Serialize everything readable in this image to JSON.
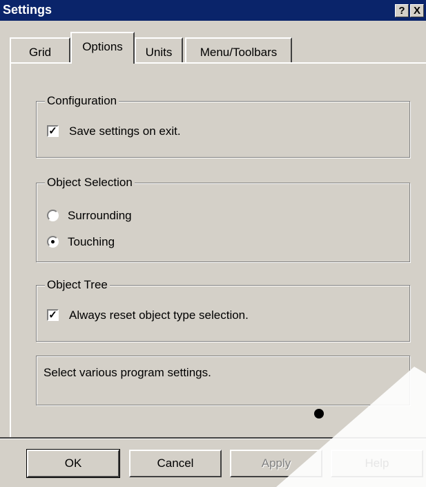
{
  "window": {
    "title": "Settings"
  },
  "titlebar": {
    "help_label": "?",
    "close_label": "X"
  },
  "tabs": [
    {
      "label": "Grid",
      "active": false
    },
    {
      "label": "Options",
      "active": true
    },
    {
      "label": "Units",
      "active": false
    },
    {
      "label": "Menu/Toolbars",
      "active": false
    }
  ],
  "configuration": {
    "title": "Configuration",
    "save_on_exit": {
      "label": "Save settings on exit.",
      "checked": true
    }
  },
  "object_selection": {
    "title": "Object Selection",
    "options": [
      {
        "label": "Surrounding",
        "selected": false
      },
      {
        "label": "Touching",
        "selected": true
      }
    ]
  },
  "object_tree": {
    "title": "Object Tree",
    "reset_selection": {
      "label": "Always reset object type selection.",
      "checked": true
    }
  },
  "status": {
    "text": "Select various program settings."
  },
  "buttons": {
    "ok": "OK",
    "cancel": "Cancel",
    "apply": "Apply",
    "help": "Help"
  },
  "colors": {
    "face": "#d4d0c8",
    "titlebar": "#0a246a",
    "shadow": "#808080",
    "highlight": "#ffffff"
  }
}
